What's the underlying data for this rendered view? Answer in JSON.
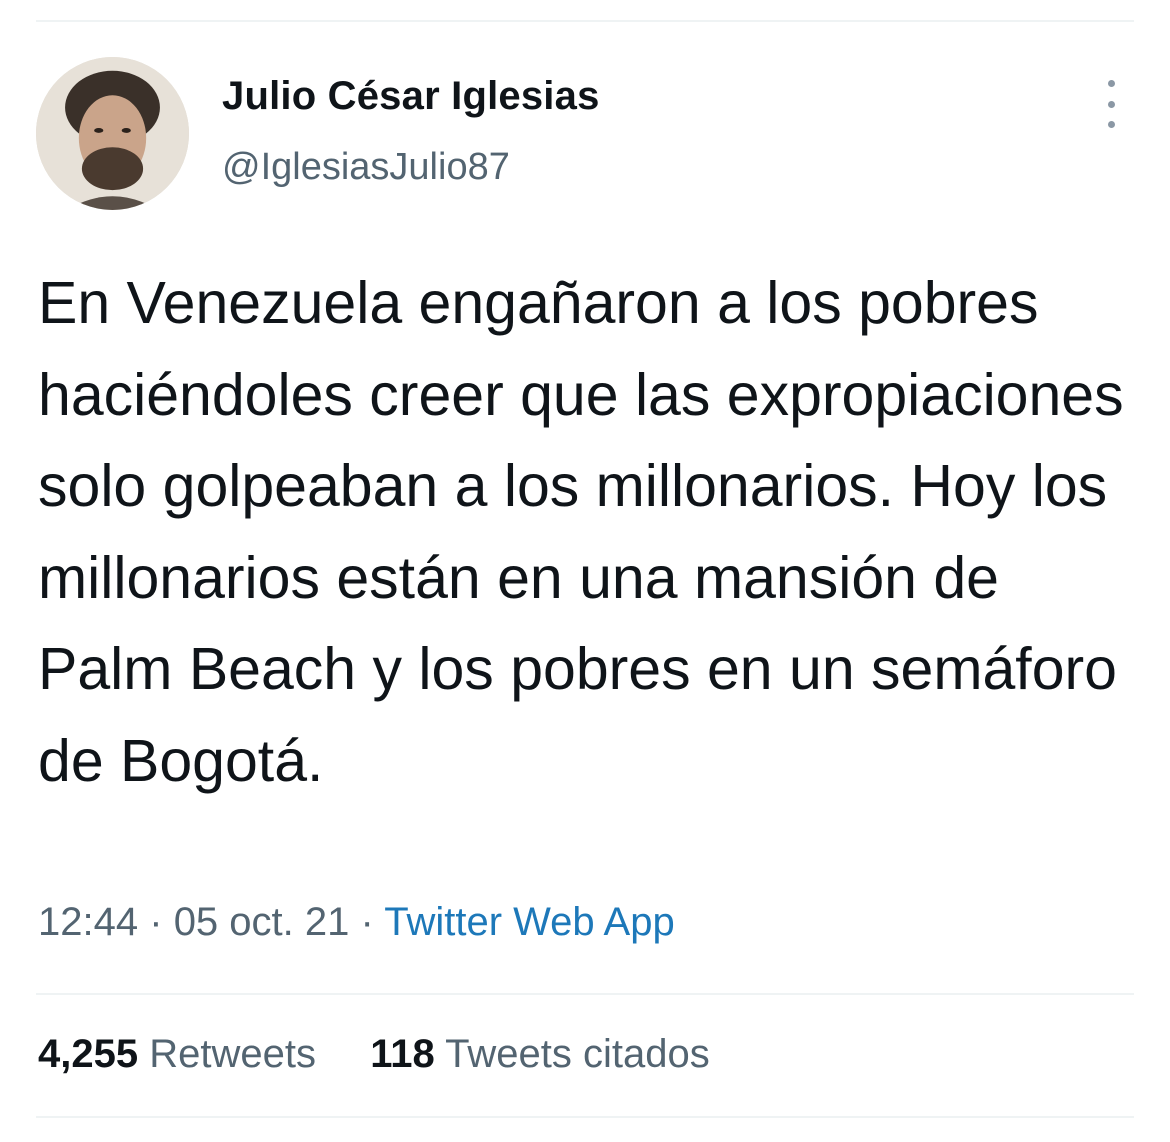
{
  "author": {
    "display_name": "Julio César Iglesias",
    "handle": "@IglesiasJulio87"
  },
  "tweet": {
    "text": "En Venezuela engañaron a los pobres haciéndoles creer que las expropiaciones solo golpeaban a los millonarios. Hoy los millonarios están en una mansión de Palm Beach y los pobres en un semáforo de Bogotá.",
    "time": "12:44",
    "separator": "·",
    "date": "05 oct. 21",
    "source": "Twitter Web App"
  },
  "stats": {
    "retweets_count": "4,255",
    "retweets_label": "Retweets",
    "quotes_count": "118",
    "quotes_label": "Tweets citados"
  },
  "icons": {
    "more": "more-vertical-icon"
  },
  "colors": {
    "text": "#0f1419",
    "secondary": "#536471",
    "link": "#1d78b9",
    "divider": "#eff3f4"
  }
}
